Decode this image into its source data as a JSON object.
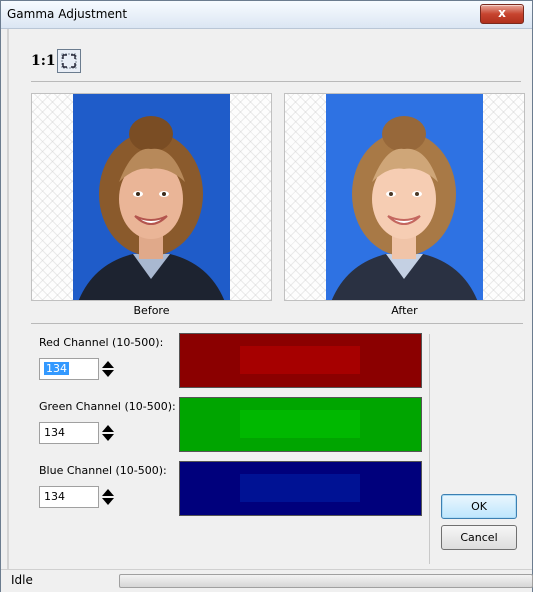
{
  "window": {
    "title": "Gamma Adjustment",
    "close_glyph": "x"
  },
  "toolbar": {
    "zoom_label": "1:1",
    "fit_icon": "fit-to-window-icon"
  },
  "previews": {
    "before_label": "Before",
    "after_label": "After"
  },
  "channels": [
    {
      "label": "Red Channel (10-500):",
      "value": "134",
      "color": "#8b0000",
      "inner_color": "#a00000",
      "selected": true
    },
    {
      "label": "Green Channel (10-500):",
      "value": "134",
      "color": "#00a000",
      "inner_color": "#00b000",
      "selected": false
    },
    {
      "label": "Blue Channel (10-500):",
      "value": "134",
      "color": "#000080",
      "inner_color": "#00108f",
      "selected": false
    }
  ],
  "buttons": {
    "ok": "OK",
    "cancel": "Cancel"
  },
  "status": {
    "text": "Idle",
    "progress": 0
  }
}
